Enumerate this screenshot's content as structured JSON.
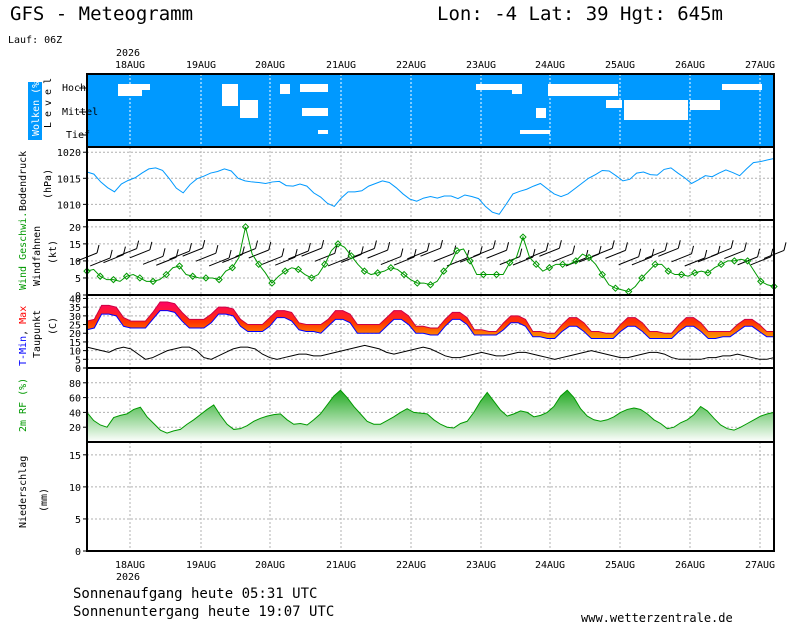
{
  "header": {
    "title": "GFS - Meteogramm",
    "location": "Lon: -4 Lat: 39 Hgt: 645m",
    "run": "Lauf: 06Z"
  },
  "dates": {
    "labels": [
      "18AUG",
      "19AUG",
      "20AUG",
      "21AUG",
      "22AUG",
      "23AUG",
      "24AUG",
      "25AUG",
      "26AUG",
      "27AUG"
    ],
    "year": "2026"
  },
  "footer": {
    "sunrise": "Sonnenaufgang heute 05:31 UTC",
    "sunset": "Sonnenuntergang heute 19:07 UTC",
    "url": "www.wetterzentrale.de"
  },
  "colors": {
    "clouds": "#0099ff",
    "pressure": "#0099ff",
    "wind": "#009900",
    "tmin": "#0000ff",
    "tmax": "#ff0000",
    "rh": "#009900",
    "dew": "#000000"
  },
  "chart_data": [
    {
      "type": "area",
      "id": "clouds",
      "ylabel": "Wolken (%)",
      "levels_label": "Level",
      "levels": [
        "Hoch",
        "Mittel",
        "Tief"
      ]
    },
    {
      "type": "line",
      "id": "pressure",
      "ylabel": "Bodendruck",
      "unit": "(hPa)",
      "ylim": [
        1007,
        1021
      ],
      "yticks": [
        1010,
        1015,
        1020
      ],
      "x": [
        0,
        0.25,
        0.5,
        0.75,
        1,
        1.25,
        1.5,
        1.75,
        2,
        2.25,
        2.5,
        2.75,
        3,
        3.25,
        3.5,
        3.75,
        4,
        4.25,
        4.5,
        4.75,
        5,
        5.25,
        5.5,
        5.75,
        6,
        6.25,
        6.5,
        6.75,
        7,
        7.25,
        7.5,
        7.75,
        8,
        8.25,
        8.5,
        8.75,
        9,
        9.25,
        9.5,
        9.75,
        10,
        10.25,
        10.5,
        10.75,
        11,
        11.25,
        11.5,
        11.75,
        12,
        12.25,
        12.5,
        12.75,
        13,
        13.25,
        13.5,
        13.75,
        14,
        14.25,
        14.5,
        14.75,
        15,
        15.25,
        15.5,
        15.75,
        16,
        16.25,
        16.5,
        16.75,
        17,
        17.25,
        17.5,
        17.75,
        18,
        18.25,
        18.5,
        18.75,
        19,
        19.25,
        19.5,
        19.75,
        20,
        20.25,
        20.5,
        20.75,
        21,
        21.25,
        21.5,
        21.75,
        22,
        22.25,
        22.5,
        22.75,
        23,
        23.25,
        23.5,
        23.75,
        24,
        24.25,
        24.5,
        24.75,
        25,
        25.25,
        25.5,
        25.75,
        26,
        26.25,
        26.5,
        26.75,
        27,
        27.25,
        27.5,
        27.75,
        28,
        28.25,
        28.5,
        28.75,
        29,
        29.25,
        29.5,
        29.75,
        30,
        30.25,
        30.5,
        30.75,
        31,
        31.25,
        31.5,
        31.75,
        32,
        32.25,
        32.5,
        32.75,
        33,
        33.25,
        33.5,
        33.75,
        34,
        34.25,
        34.5,
        34.75,
        35,
        35.25,
        35.5,
        35.75,
        36,
        36.25,
        36.5,
        36.75,
        37,
        37.25
      ],
      "values": [
        1016.2,
        1015.8,
        1014.3,
        1013.2,
        1012.4,
        1013.9,
        1014.6,
        1015.1,
        1016.0,
        1016.8,
        1017.0,
        1016.5,
        1014.9,
        1013.1,
        1012.2,
        1013.8,
        1014.9,
        1015.4,
        1016.0,
        1016.3,
        1016.8,
        1016.4,
        1015.0,
        1014.5,
        1014.3,
        1014.2,
        1014.0,
        1014.3,
        1014.4,
        1013.6,
        1013.5,
        1013.9,
        1013.5,
        1012.2,
        1011.4,
        1010.2,
        1009.6,
        1011.2,
        1012.4,
        1012.4,
        1012.6,
        1013.5,
        1014.0,
        1014.5,
        1014.2,
        1013.2,
        1012.0,
        1011.0,
        1010.6,
        1011.2,
        1011.5,
        1011.2,
        1011.6,
        1011.6,
        1011.1,
        1011.8,
        1011.5,
        1011.1,
        1009.6,
        1008.5,
        1008.1,
        1010.0,
        1012.0,
        1012.5,
        1012.9,
        1013.5,
        1014.0,
        1013.0,
        1012.0,
        1011.5,
        1012.0,
        1013.0,
        1014.0,
        1015.0,
        1015.7,
        1016.5,
        1016.4,
        1015.5,
        1014.5,
        1014.8,
        1016.0,
        1016.2,
        1015.7,
        1015.6,
        1016.7,
        1017.0,
        1016.0,
        1015.1,
        1014.0,
        1014.7,
        1015.5,
        1015.3,
        1016.0,
        1016.6,
        1016.1,
        1015.5,
        1016.8,
        1018.0,
        1018.2,
        1018.5,
        1018.8
      ],
      "trim": 101
    },
    {
      "type": "line",
      "id": "wind",
      "ylabel": "Wind Geschwi.",
      "ylabel2": "Windfahnen",
      "unit": "(kt)",
      "ylim": [
        0,
        22
      ],
      "yticks": [
        0,
        5,
        10,
        15,
        20
      ],
      "values": [
        7,
        7.5,
        5.5,
        4.5,
        4.5,
        4,
        5.5,
        6,
        5,
        4,
        4,
        4.5,
        6,
        8,
        8.5,
        6,
        5.5,
        5,
        5,
        5,
        4.5,
        7,
        8,
        11,
        20,
        12,
        9,
        6.5,
        3.5,
        5.5,
        7,
        8,
        7.5,
        6,
        5,
        6,
        9,
        13,
        15,
        14,
        11.5,
        9,
        7,
        6,
        6.5,
        7,
        8,
        7.5,
        6,
        4.5,
        3.5,
        3.5,
        3,
        4,
        7,
        9,
        13,
        13.5,
        10,
        6,
        6,
        6,
        6,
        6,
        9.5,
        11,
        17,
        11,
        9,
        7,
        8,
        9,
        9,
        9,
        10,
        12,
        11,
        9,
        6,
        3,
        2,
        1.5,
        1,
        2.5,
        5,
        7,
        9,
        9,
        7,
        6,
        6,
        5.5,
        6.5,
        7,
        6.5,
        8,
        9,
        10,
        10,
        10.5,
        10,
        7,
        4,
        3,
        2.5
      ]
    },
    {
      "type": "area",
      "id": "temperature",
      "ylabel": "T-Min, Max",
      "ylabel2": "Taupunkt",
      "unit": "(C)",
      "ylim": [
        0,
        42
      ],
      "yticks": [
        0,
        5,
        10,
        15,
        20,
        25,
        30,
        35,
        40
      ],
      "tmin": [
        22,
        23,
        31,
        31,
        30,
        24,
        23,
        23,
        23,
        28,
        33,
        33,
        32,
        27,
        23,
        23,
        23,
        26,
        31,
        31,
        30,
        24,
        21,
        21,
        21,
        24,
        29,
        29,
        27,
        22,
        21,
        21,
        20,
        24,
        28,
        28,
        26,
        20,
        20,
        20,
        20,
        24,
        28,
        28,
        25,
        20,
        20,
        19,
        19,
        24,
        28,
        28,
        25,
        19,
        19,
        19,
        19,
        22,
        26,
        26,
        24,
        18,
        18,
        17,
        17,
        21,
        24,
        24,
        21,
        17,
        17,
        17,
        17,
        21,
        24,
        24,
        21,
        17,
        17,
        17,
        17,
        21,
        24,
        24,
        21,
        17,
        17,
        18,
        18,
        21,
        24,
        24,
        21,
        18,
        18
      ],
      "tmax": [
        27,
        28,
        36,
        36,
        35,
        29,
        27,
        27,
        27,
        32,
        38,
        38,
        37,
        32,
        28,
        28,
        28,
        31,
        35,
        35,
        34,
        28,
        25,
        25,
        25,
        29,
        33,
        33,
        32,
        26,
        25,
        25,
        25,
        28,
        33,
        33,
        31,
        25,
        25,
        25,
        25,
        29,
        33,
        33,
        30,
        24,
        24,
        23,
        23,
        28,
        32,
        32,
        29,
        22,
        22,
        21,
        21,
        26,
        30,
        30,
        28,
        21,
        21,
        20,
        20,
        25,
        29,
        29,
        26,
        21,
        21,
        20,
        20,
        25,
        29,
        29,
        26,
        21,
        21,
        20,
        20,
        25,
        29,
        29,
        26,
        21,
        21,
        21,
        21,
        25,
        28,
        28,
        25,
        21,
        21
      ],
      "dewpoint": [
        12,
        11,
        10,
        9,
        11,
        12,
        11,
        8,
        5,
        6,
        8,
        10,
        11,
        12,
        12,
        10,
        6,
        5,
        7,
        9,
        11,
        12,
        12,
        11,
        8,
        6,
        5,
        6,
        7,
        8,
        8,
        7,
        7,
        8,
        9,
        10,
        11,
        12,
        13,
        12,
        11,
        9,
        8,
        9,
        10,
        11,
        12,
        11,
        9,
        7,
        6,
        6,
        7,
        8,
        9,
        8,
        7,
        7,
        8,
        9,
        9,
        8,
        7,
        6,
        5,
        6,
        7,
        8,
        9,
        10,
        9,
        8,
        7,
        6,
        6,
        7,
        8,
        9,
        9,
        8,
        6,
        5,
        5,
        5,
        5,
        6,
        6,
        7,
        7,
        8,
        7,
        6,
        5,
        5,
        6
      ]
    },
    {
      "type": "area",
      "id": "rh",
      "ylabel": "2m RF (%)",
      "ylim": [
        0,
        100
      ],
      "yticks": [
        20,
        40,
        60,
        80
      ],
      "values": [
        40,
        29,
        23,
        20,
        33,
        36,
        38,
        44,
        47,
        34,
        25,
        16,
        12,
        15,
        17,
        24,
        30,
        37,
        44,
        50,
        36,
        24,
        17,
        18,
        22,
        28,
        32,
        35,
        37,
        38,
        30,
        24,
        25,
        23,
        30,
        38,
        50,
        62,
        70,
        60,
        48,
        38,
        28,
        24,
        24,
        29,
        34,
        40,
        45,
        40,
        39,
        38,
        30,
        24,
        20,
        19,
        25,
        28,
        40,
        55,
        67,
        55,
        43,
        35,
        38,
        42,
        40,
        34,
        36,
        40,
        48,
        62,
        70,
        60,
        45,
        35,
        30,
        28,
        30,
        34,
        40,
        44,
        46,
        44,
        38,
        30,
        25,
        18,
        20,
        26,
        30,
        37,
        48,
        42,
        32,
        23,
        18,
        16,
        20,
        25,
        30,
        35,
        38,
        40
      ]
    },
    {
      "type": "bar",
      "id": "precip",
      "ylabel": "Niederschlag",
      "unit": "(mm)",
      "ylim": [
        0,
        17
      ],
      "yticks": [
        0,
        5,
        10,
        15
      ],
      "values": []
    }
  ]
}
